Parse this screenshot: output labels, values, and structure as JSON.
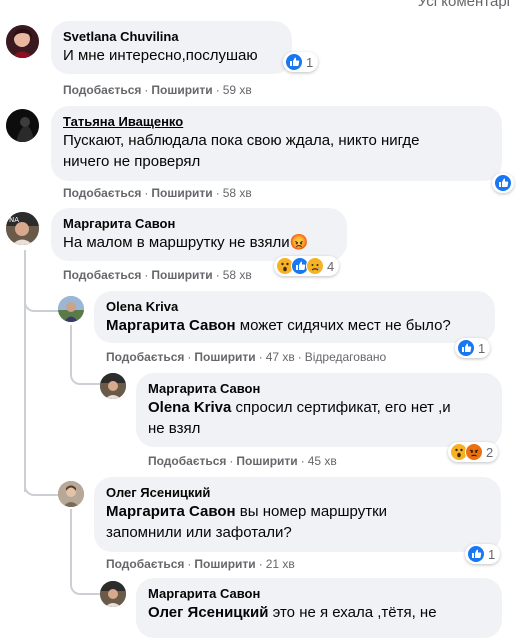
{
  "header": {
    "all_comments": "Усі коментарі"
  },
  "actions": {
    "like": "Подобається",
    "share": "Поширити",
    "separator": "·",
    "edited": "Відредаговано"
  },
  "comments": [
    {
      "author": "Svetlana Chuvilina",
      "text": "И мне интересно,послушаю",
      "time": "59 хв",
      "reactions": {
        "icons": [
          "like-icon"
        ],
        "count": "1"
      }
    },
    {
      "author": "Татьяна Иващенко",
      "text_line1": "Пускают, наблюдала пока свою ждала, никто нигде",
      "text_line2": "ничего не проверял",
      "time": "58 хв",
      "reactions": {
        "icons": [
          "like-icon"
        ],
        "count": ""
      }
    },
    {
      "author": "Маргарита Савон",
      "text": "На малом в маршрутку не взяли",
      "emoji": "😡",
      "time": "58 хв",
      "reactions": {
        "icons": [
          "wow-icon",
          "like-icon",
          "sad-icon"
        ],
        "count": "4"
      }
    }
  ],
  "replies": [
    {
      "author": "Olena Kriva",
      "mention": "Маргарита Савон",
      "text": " может сидячих мест не было?",
      "time": "47 хв",
      "edited": true,
      "reactions": {
        "icons": [
          "like-icon"
        ],
        "count": "1"
      }
    },
    {
      "author": "Маргарита Савон",
      "mention": "Olena Kriva",
      "text": " спросил сертификат, его нет ,и",
      "text_line2": "не взял",
      "time": "45 хв",
      "reactions": {
        "icons": [
          "wow-icon",
          "angry-icon"
        ],
        "count": "2"
      }
    },
    {
      "author": "Олег Ясеницкий",
      "mention": "Маргарита Савон",
      "text": " вы номер маршрутки",
      "text_line2": "запомнили или зафотали?",
      "time": "21 хв",
      "reactions": {
        "icons": [
          "like-icon"
        ],
        "count": "1"
      }
    },
    {
      "author": "Маргарита Савон",
      "mention": "Олег Ясеницкий",
      "text": " это не я ехала ,тётя, не"
    }
  ],
  "colors": {
    "like": "#1877f2",
    "wow": "#f7b125",
    "angry": "#e9710f",
    "bubble": "#f0f2f5",
    "meta": "#65676b"
  }
}
